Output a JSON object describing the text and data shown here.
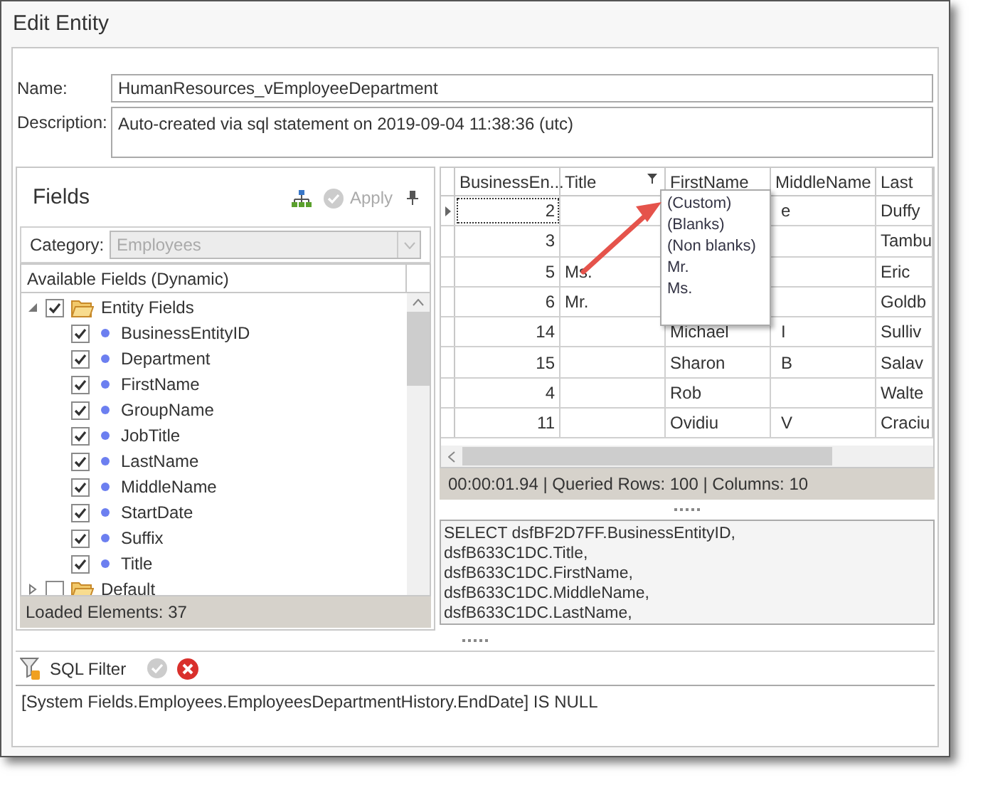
{
  "window": {
    "title": "Edit Entity"
  },
  "name": {
    "label": "Name:",
    "value": "HumanResources_vEmployeeDepartment"
  },
  "description": {
    "label": "Description:",
    "value": "Auto-created via sql statement on 2019-09-04 11:38:36 (utc)"
  },
  "fields_panel": {
    "title": "Fields",
    "apply": {
      "label": "Apply",
      "disabled": true
    },
    "category": {
      "label": "Category:",
      "value": "Employees"
    },
    "tree_header": "Available Fields (Dynamic)",
    "tree": [
      {
        "label": "Entity Fields",
        "checked": true,
        "expanded": true,
        "children": [
          {
            "label": "BusinessEntityID",
            "checked": true
          },
          {
            "label": "Department",
            "checked": true
          },
          {
            "label": "FirstName",
            "checked": true
          },
          {
            "label": "GroupName",
            "checked": true
          },
          {
            "label": "JobTitle",
            "checked": true
          },
          {
            "label": "LastName",
            "checked": true
          },
          {
            "label": "MiddleName",
            "checked": true
          },
          {
            "label": "StartDate",
            "checked": true
          },
          {
            "label": "Suffix",
            "checked": true
          },
          {
            "label": "Title",
            "checked": true
          }
        ]
      },
      {
        "label": "Default",
        "checked": false,
        "expanded": false
      }
    ],
    "status": "Loaded Elements: 37"
  },
  "grid": {
    "columns": [
      "BusinessEn...",
      "Title",
      "FirstName",
      "MiddleName",
      "Last"
    ],
    "rows": [
      {
        "cells": [
          "2",
          "",
          "",
          "e",
          "Duffy"
        ],
        "selected": true
      },
      {
        "cells": [
          "3",
          "",
          "",
          "",
          "Tambu"
        ],
        "selected": false
      },
      {
        "cells": [
          "5",
          "Ms.",
          "",
          "",
          "Eric"
        ],
        "selected": false
      },
      {
        "cells": [
          "6",
          "Mr.",
          "",
          "",
          "Goldb"
        ],
        "selected": false
      },
      {
        "cells": [
          "14",
          "",
          "Michael",
          "I",
          "Sulliv"
        ],
        "selected": false
      },
      {
        "cells": [
          "15",
          "",
          "Sharon",
          "B",
          "Salav"
        ],
        "selected": false
      },
      {
        "cells": [
          "4",
          "",
          "Rob",
          "",
          "Walte"
        ],
        "selected": false
      },
      {
        "cells": [
          "11",
          "",
          "Ovidiu",
          "V",
          "Craciu"
        ],
        "selected": false
      }
    ],
    "filter_popup": [
      "(Custom)",
      "(Blanks)",
      "(Non blanks)",
      "Mr.",
      "Ms."
    ],
    "status": "00:00:01.94 | Queried Rows: 100 | Columns: 10",
    "sql": [
      "SELECT dsfBF2D7FF.BusinessEntityID,",
      "dsfB633C1DC.Title,",
      "dsfB633C1DC.FirstName,",
      "dsfB633C1DC.MiddleName,",
      "dsfB633C1DC.LastName,"
    ]
  },
  "sql_filter": {
    "label": "SQL Filter",
    "value": "[System Fields.Employees.EmployeesDepartmentHistory.EndDate] IS NULL"
  }
}
